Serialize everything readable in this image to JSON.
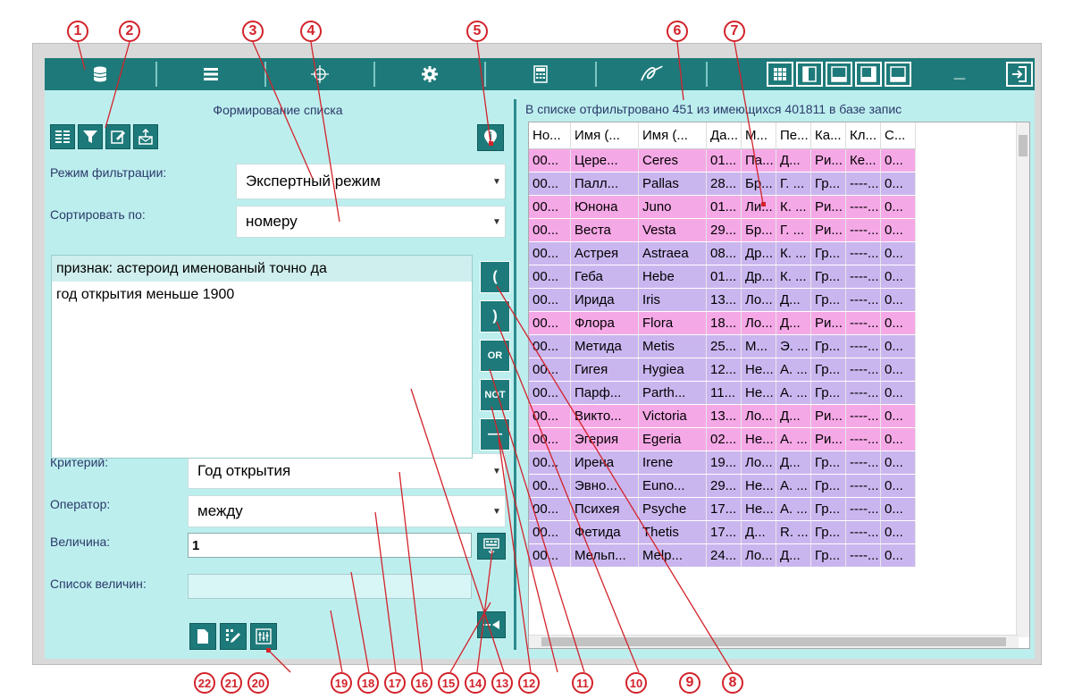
{
  "callouts_top": [
    "1",
    "2",
    "3",
    "4",
    "5",
    "6",
    "7"
  ],
  "callouts_bottom": [
    "22",
    "21",
    "20",
    "19",
    "18",
    "17",
    "16",
    "15",
    "14",
    "13",
    "12",
    "11",
    "10",
    "9",
    "8"
  ],
  "toolbar": {
    "icons": [
      "database-icon",
      "list-icon",
      "target-icon",
      "gear-icon",
      "calculator-icon",
      "signature-icon"
    ],
    "view_icons": [
      "grid-view-icon",
      "left-panel-view-icon",
      "bottom-panel-view-icon",
      "bottom-right-panel-view-icon",
      "bottom-left-panel-view-icon",
      "minimize-icon",
      "exit-icon"
    ],
    "minimize_glyph": "_"
  },
  "left": {
    "title": "Формирование списка",
    "filter_mode_label": "Режим фильтрации:",
    "filter_mode_value": "Экспертный режим",
    "sort_label": "Сортировать по:",
    "sort_value": "номеру",
    "criteria": [
      "признак: астероид именованый точно да",
      "год открытия меньше 1900"
    ],
    "criterion_label": "Критерий:",
    "criterion_value": "Год открытия",
    "operator_label": "Оператор:",
    "operator_value": "между",
    "value_label": "Величина:",
    "value_value": "1",
    "values_list_label": "Список величин:",
    "values_list_value": "",
    "op_buttons": [
      "(",
      ")",
      "OR",
      "NOT",
      "—"
    ],
    "bottom_icons": [
      "new-document-icon",
      "edit-icon",
      "sliders-icon"
    ]
  },
  "right": {
    "status": "В списке отфильтровано 451 из имеющихся 401811 в базе запис",
    "columns": [
      "Но...",
      "Имя (...",
      "Имя (...",
      "Да...",
      "М...",
      "Пе...",
      "Ка...",
      "Кл...",
      "С..."
    ],
    "rows": [
      {
        "c": [
          "00...",
          "Цере...",
          "Ceres",
          "01...",
          "Па...",
          "Д...",
          "Ри...",
          "Ке...",
          "0..."
        ],
        "color": "pink"
      },
      {
        "c": [
          "00...",
          "Палл...",
          "Pallas",
          "28...",
          "Бр...",
          "Г. ...",
          "Гр...",
          "----...",
          "0..."
        ],
        "color": "violet"
      },
      {
        "c": [
          "00...",
          "Юнона",
          "Juno",
          "01...",
          "Ли...",
          "К. ...",
          "Ри...",
          "----...",
          "0..."
        ],
        "color": "pink"
      },
      {
        "c": [
          "00...",
          "Веста",
          "Vesta",
          "29...",
          "Бр...",
          "Г. ...",
          "Ри...",
          "----...",
          "0..."
        ],
        "color": "pink"
      },
      {
        "c": [
          "00...",
          "Астрея",
          "Astraea",
          "08...",
          "Др...",
          "К. ...",
          "Гр...",
          "----...",
          "0..."
        ],
        "color": "violet"
      },
      {
        "c": [
          "00...",
          "Геба",
          "Hebe",
          "01...",
          "Др...",
          "К. ...",
          "Гр...",
          "----...",
          "0..."
        ],
        "color": "violet"
      },
      {
        "c": [
          "00...",
          "Ирида",
          "Iris",
          "13...",
          "Ло...",
          "Д...",
          "Гр...",
          "----...",
          "0..."
        ],
        "color": "violet"
      },
      {
        "c": [
          "00...",
          "Флора",
          "Flora",
          "18...",
          "Ло...",
          "Д...",
          "Ри...",
          "----...",
          "0..."
        ],
        "color": "pink"
      },
      {
        "c": [
          "00...",
          "Метида",
          "Metis",
          "25...",
          "М...",
          "Э. ...",
          "Гр...",
          "----...",
          "0..."
        ],
        "color": "violet"
      },
      {
        "c": [
          "00...",
          "Гигея",
          "Hygiea",
          "12...",
          "Не...",
          "А. ...",
          "Гр...",
          "----...",
          "0..."
        ],
        "color": "violet"
      },
      {
        "c": [
          "00...",
          "Парф...",
          "Parth...",
          "11...",
          "Не...",
          "А. ...",
          "Гр...",
          "----...",
          "0..."
        ],
        "color": "violet"
      },
      {
        "c": [
          "00...",
          "Викто...",
          "Victoria",
          "13...",
          "Ло...",
          "Д...",
          "Ри...",
          "----...",
          "0..."
        ],
        "color": "pink"
      },
      {
        "c": [
          "00...",
          "Эгерия",
          "Egeria",
          "02...",
          "Не...",
          "А. ...",
          "Ри...",
          "----...",
          "0..."
        ],
        "color": "pink"
      },
      {
        "c": [
          "00...",
          "Ирена",
          "Irene",
          "19...",
          "Ло...",
          "Д...",
          "Гр...",
          "----...",
          "0..."
        ],
        "color": "violet"
      },
      {
        "c": [
          "00...",
          "Эвно...",
          "Euno...",
          "29...",
          "Не...",
          "А. ...",
          "Гр...",
          "----...",
          "0..."
        ],
        "color": "violet"
      },
      {
        "c": [
          "00...",
          "Психея",
          "Psyche",
          "17...",
          "Не...",
          "А. ...",
          "Гр...",
          "----...",
          "0..."
        ],
        "color": "violet"
      },
      {
        "c": [
          "00...",
          "Фетида",
          "Thetis",
          "17...",
          "Д...",
          "R. ...",
          "Гр...",
          "----...",
          "0..."
        ],
        "color": "violet"
      },
      {
        "c": [
          "00...",
          "Мельп...",
          "Melp...",
          "24...",
          "Ло...",
          "Д...",
          "Гр...",
          "----...",
          "0..."
        ],
        "color": "violet"
      }
    ]
  },
  "colors": {
    "accent": "#1e7a7a",
    "panel": "#bdeeee",
    "row_pink": "#f5a8e6",
    "row_violet": "#cab6ef",
    "callout": "#d2232a"
  }
}
